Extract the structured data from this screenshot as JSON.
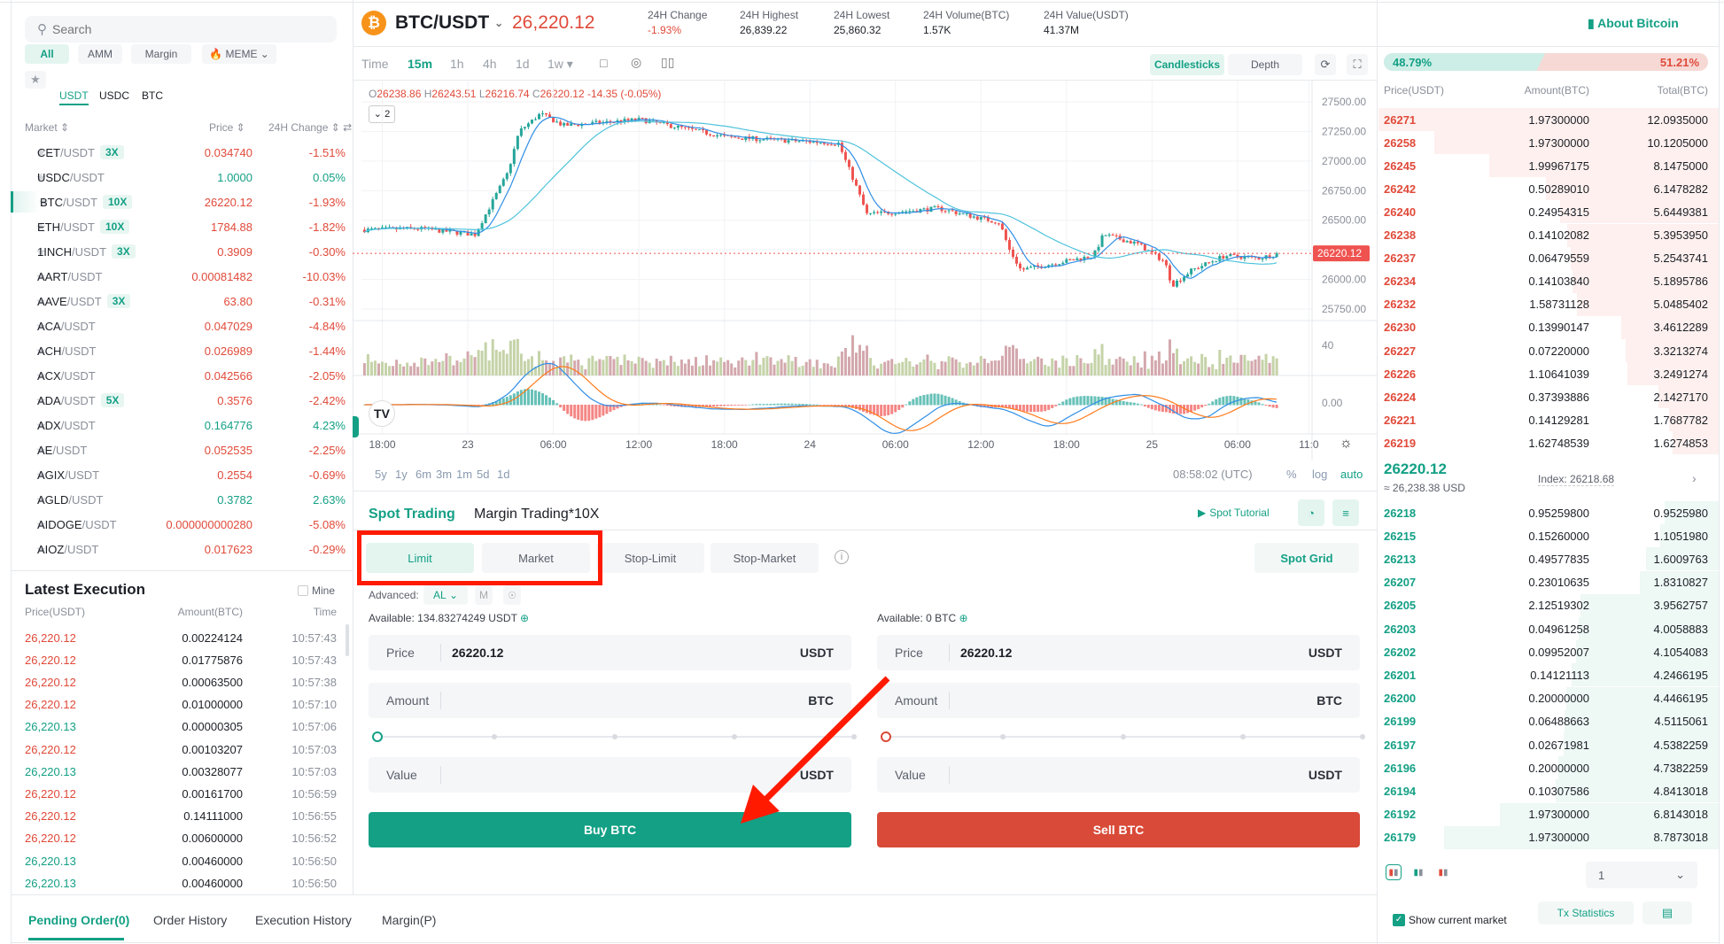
{
  "colors": {
    "up": "#14a085",
    "down": "#e04a3a",
    "accent": "#14a085",
    "highlight_box": "#ff1a00"
  },
  "sidebar": {
    "search_placeholder": "Search",
    "filters": [
      "All",
      "AMM",
      "Margin",
      "MEME"
    ],
    "quote_tabs": [
      "USDT",
      "USDC",
      "BTC"
    ],
    "headers": {
      "market": "Market",
      "price": "Price",
      "change": "24H Change"
    },
    "markets": [
      {
        "base": "CET",
        "quote": "/USDT",
        "badge": "3X",
        "price": "0.034740",
        "change": "-1.51%",
        "dir": "down"
      },
      {
        "base": "USDC",
        "quote": "/USDT",
        "badge": "",
        "price": "1.0000",
        "change": "0.05%",
        "dir": "up"
      },
      {
        "base": "BTC",
        "quote": "/USDT",
        "badge": "10X",
        "price": "26220.12",
        "change": "-1.93%",
        "dir": "down",
        "active": true
      },
      {
        "base": "ETH",
        "quote": "/USDT",
        "badge": "10X",
        "price": "1784.88",
        "change": "-1.82%",
        "dir": "down"
      },
      {
        "base": "1INCH",
        "quote": "/USDT",
        "badge": "3X",
        "price": "0.3909",
        "change": "-0.30%",
        "dir": "down"
      },
      {
        "base": "AART",
        "quote": "/USDT",
        "badge": "",
        "price": "0.00081482",
        "change": "-10.03%",
        "dir": "down"
      },
      {
        "base": "AAVE",
        "quote": "/USDT",
        "badge": "3X",
        "price": "63.80",
        "change": "-0.31%",
        "dir": "down"
      },
      {
        "base": "ACA",
        "quote": "/USDT",
        "badge": "",
        "price": "0.047029",
        "change": "-4.84%",
        "dir": "down"
      },
      {
        "base": "ACH",
        "quote": "/USDT",
        "badge": "",
        "price": "0.026989",
        "change": "-1.44%",
        "dir": "down"
      },
      {
        "base": "ACX",
        "quote": "/USDT",
        "badge": "",
        "price": "0.042566",
        "change": "-2.05%",
        "dir": "down"
      },
      {
        "base": "ADA",
        "quote": "/USDT",
        "badge": "5X",
        "price": "0.3576",
        "change": "-2.42%",
        "dir": "down"
      },
      {
        "base": "ADX",
        "quote": "/USDT",
        "badge": "",
        "price": "0.164776",
        "change": "4.23%",
        "dir": "up"
      },
      {
        "base": "AE",
        "quote": "/USDT",
        "badge": "",
        "price": "0.052535",
        "change": "-2.25%",
        "dir": "down"
      },
      {
        "base": "AGIX",
        "quote": "/USDT",
        "badge": "",
        "price": "0.2554",
        "change": "-0.69%",
        "dir": "down"
      },
      {
        "base": "AGLD",
        "quote": "/USDT",
        "badge": "",
        "price": "0.3782",
        "change": "2.63%",
        "dir": "up"
      },
      {
        "base": "AIDOGE",
        "quote": "/USDT",
        "badge": "",
        "price": "0.000000000280",
        "change": "-5.08%",
        "dir": "down"
      },
      {
        "base": "AIOZ",
        "quote": "/USDT",
        "badge": "",
        "price": "0.017623",
        "change": "-0.29%",
        "dir": "down"
      }
    ]
  },
  "executions": {
    "title": "Latest Execution",
    "mine_label": "Mine",
    "headers": [
      "Price(USDT)",
      "Amount(BTC)",
      "Time"
    ],
    "rows": [
      [
        "26,220.12",
        "0.00224124",
        "10:57:43",
        "down"
      ],
      [
        "26,220.12",
        "0.01775876",
        "10:57:43",
        "down"
      ],
      [
        "26,220.12",
        "0.00063500",
        "10:57:38",
        "down"
      ],
      [
        "26,220.12",
        "0.01000000",
        "10:57:10",
        "down"
      ],
      [
        "26,220.13",
        "0.00000305",
        "10:57:06",
        "up"
      ],
      [
        "26,220.12",
        "0.00103207",
        "10:57:03",
        "down"
      ],
      [
        "26,220.13",
        "0.00328077",
        "10:57:03",
        "up"
      ],
      [
        "26,220.12",
        "0.00161700",
        "10:56:59",
        "down"
      ],
      [
        "26,220.12",
        "0.14111000",
        "10:56:55",
        "down"
      ],
      [
        "26,220.12",
        "0.00600000",
        "10:56:52",
        "down"
      ],
      [
        "26,220.13",
        "0.00460000",
        "10:56:50",
        "up"
      ],
      [
        "26,220.13",
        "0.00460000",
        "10:56:50",
        "up"
      ]
    ]
  },
  "header": {
    "pair": "BTC/USDT",
    "price": "26,220.12",
    "stats": [
      {
        "label": "24H Change",
        "value": "-1.93%",
        "dir": "down"
      },
      {
        "label": "24H Highest",
        "value": "26,839.22"
      },
      {
        "label": "24H Lowest",
        "value": "25,860.32"
      },
      {
        "label": "24H Volume(BTC)",
        "value": "1.57K"
      },
      {
        "label": "24H Value(USDT)",
        "value": "41.37M"
      }
    ],
    "about": "About Bitcoin"
  },
  "chart_toolbar": {
    "intervals": [
      "Time",
      "15m",
      "1h",
      "4h",
      "1d",
      "1w"
    ],
    "active": "15m",
    "views": [
      "Candlesticks",
      "Depth"
    ],
    "ohlc": {
      "o": "26238.86",
      "h": "26243.51",
      "l": "26216.74",
      "c": "26220.12",
      "chg": "-14.35 (-0.05%)"
    },
    "indicator_count": "2",
    "ranges": [
      "5y",
      "1y",
      "6m",
      "3m",
      "1m",
      "5d",
      "1d"
    ],
    "clock": "08:58:02 (UTC)",
    "scale_opts": [
      "%",
      "log",
      "auto"
    ]
  },
  "chart_data": {
    "type": "candlestick",
    "interval": "15m",
    "price_ticks": [
      27500,
      27250,
      27000,
      26750,
      26500,
      26250,
      26000,
      25750
    ],
    "price_tick_labels": [
      "27500.00",
      "27250.00",
      "27000.00",
      "26750.00",
      "26500.00",
      "",
      "26000.00",
      "25750.00"
    ],
    "ylim": [
      25750,
      27500
    ],
    "last_price": "26220.12",
    "volume_tick": "40",
    "macd_tick": "0.00",
    "time_ticks": [
      [
        "22 18:00",
        "18:00"
      ],
      [
        "23 00:00",
        "23"
      ],
      [
        "23 06:00",
        "06:00"
      ],
      [
        "23 12:00",
        "12:00"
      ],
      [
        "23 18:00",
        "18:00"
      ],
      [
        "24 00:00",
        "24"
      ],
      [
        "24 06:00",
        "06:00"
      ],
      [
        "24 12:00",
        "12:00"
      ],
      [
        "24 18:00",
        "18:00"
      ],
      [
        "25 00:00",
        "25"
      ],
      [
        "25 06:00",
        "06:00"
      ],
      [
        "25 11:00",
        "11:0"
      ]
    ],
    "price_path": [
      [
        "22 16:45",
        26420
      ],
      [
        "22 20:36",
        26430
      ],
      [
        "23 00:30",
        26380
      ],
      [
        "23 02:48",
        26900
      ],
      [
        "23 03:36",
        27250
      ],
      [
        "23 05:06",
        27400
      ],
      [
        "23 06:42",
        27300
      ],
      [
        "23 12:06",
        27350
      ],
      [
        "23 18:18",
        27200
      ],
      [
        "24 02:00",
        27150
      ],
      [
        "24 03:12",
        26800
      ],
      [
        "24 04:00",
        26550
      ],
      [
        "24 09:00",
        26600
      ],
      [
        "24 13:18",
        26480
      ],
      [
        "24 14:00",
        26250
      ],
      [
        "24 14:48",
        26080
      ],
      [
        "24 19:54",
        26200
      ],
      [
        "24 20:36",
        26380
      ],
      [
        "24 23:00",
        26300
      ],
      [
        "25 00:54",
        26150
      ],
      [
        "25 01:24",
        25950
      ],
      [
        "25 02:48",
        26080
      ],
      [
        "25 05:06",
        26200
      ],
      [
        "25 07:30",
        26180
      ],
      [
        "25 08:54",
        26220
      ]
    ]
  },
  "trade": {
    "tabs": [
      "Spot Trading",
      "Margin Trading*10X"
    ],
    "tutorial": "Spot Tutorial",
    "order_types": [
      "Limit",
      "Market",
      "Stop-Limit",
      "Stop-Market"
    ],
    "spot_grid": "Spot Grid",
    "advanced_label": "Advanced:",
    "advanced_value": "AL",
    "advanced_m": "M",
    "buy": {
      "available": "Available: 134.83274249 USDT",
      "price_label": "Price",
      "price": "26220.12",
      "price_unit": "USDT",
      "amount_label": "Amount",
      "amount_unit": "BTC",
      "value_label": "Value",
      "value_unit": "USDT",
      "button": "Buy BTC"
    },
    "sell": {
      "available": "Available: 0 BTC",
      "price_label": "Price",
      "price": "26220.12",
      "price_unit": "USDT",
      "amount_label": "Amount",
      "amount_unit": "BTC",
      "value_label": "Value",
      "value_unit": "USDT",
      "button": "Sell BTC"
    }
  },
  "orderbook": {
    "buy_ratio": "48.79%",
    "sell_ratio": "51.21%",
    "buy_ratio_value": 48.79,
    "headers": [
      "Price(USDT)",
      "Amount(BTC)",
      "Total(BTC)"
    ],
    "asks": [
      [
        "26271",
        "1.97300000",
        "12.0935000"
      ],
      [
        "26258",
        "1.97300000",
        "10.1205000"
      ],
      [
        "26245",
        "1.99967175",
        "8.1475000"
      ],
      [
        "26242",
        "0.50289010",
        "6.1478282"
      ],
      [
        "26240",
        "0.24954315",
        "5.6449381"
      ],
      [
        "26238",
        "0.14102082",
        "5.3953950"
      ],
      [
        "26237",
        "0.06479559",
        "5.2543741"
      ],
      [
        "26234",
        "0.14103840",
        "5.1895786"
      ],
      [
        "26232",
        "1.58731128",
        "5.0485402"
      ],
      [
        "26230",
        "0.13990147",
        "3.4612289"
      ],
      [
        "26227",
        "0.07220000",
        "3.3213274"
      ],
      [
        "26226",
        "1.10641039",
        "3.2491274"
      ],
      [
        "26224",
        "0.37393886",
        "2.1427170"
      ],
      [
        "26221",
        "0.14129281",
        "1.7687782"
      ],
      [
        "26219",
        "1.62748539",
        "1.6274853"
      ]
    ],
    "mid_price": "26220.12",
    "mid_usd": "≈ 26,238.38 USD",
    "index": "Index: 26218.68",
    "bids": [
      [
        "26218",
        "0.95259800",
        "0.9525980"
      ],
      [
        "26215",
        "0.15260000",
        "1.1051980"
      ],
      [
        "26213",
        "0.49577835",
        "1.6009763"
      ],
      [
        "26207",
        "0.23010635",
        "1.8310827"
      ],
      [
        "26205",
        "2.12519302",
        "3.9562757"
      ],
      [
        "26203",
        "0.04961258",
        "4.0058883"
      ],
      [
        "26202",
        "0.09952007",
        "4.1054083"
      ],
      [
        "26201",
        "0.14121113",
        "4.2466195"
      ],
      [
        "26200",
        "0.20000000",
        "4.4466195"
      ],
      [
        "26199",
        "0.06488663",
        "4.5115061"
      ],
      [
        "26197",
        "0.02671981",
        "4.5382259"
      ],
      [
        "26196",
        "0.20000000",
        "4.7382259"
      ],
      [
        "26194",
        "0.10307586",
        "4.8413018"
      ],
      [
        "26192",
        "1.97300000",
        "6.8143018"
      ],
      [
        "26179",
        "1.97300000",
        "8.7873018"
      ]
    ],
    "depth_select": "1"
  },
  "bottom": {
    "tabs": [
      "Pending Order(0)",
      "Order History",
      "Execution History",
      "Margin(P)"
    ],
    "show_current": "Show current market",
    "tx_stats": "Tx Statistics"
  }
}
